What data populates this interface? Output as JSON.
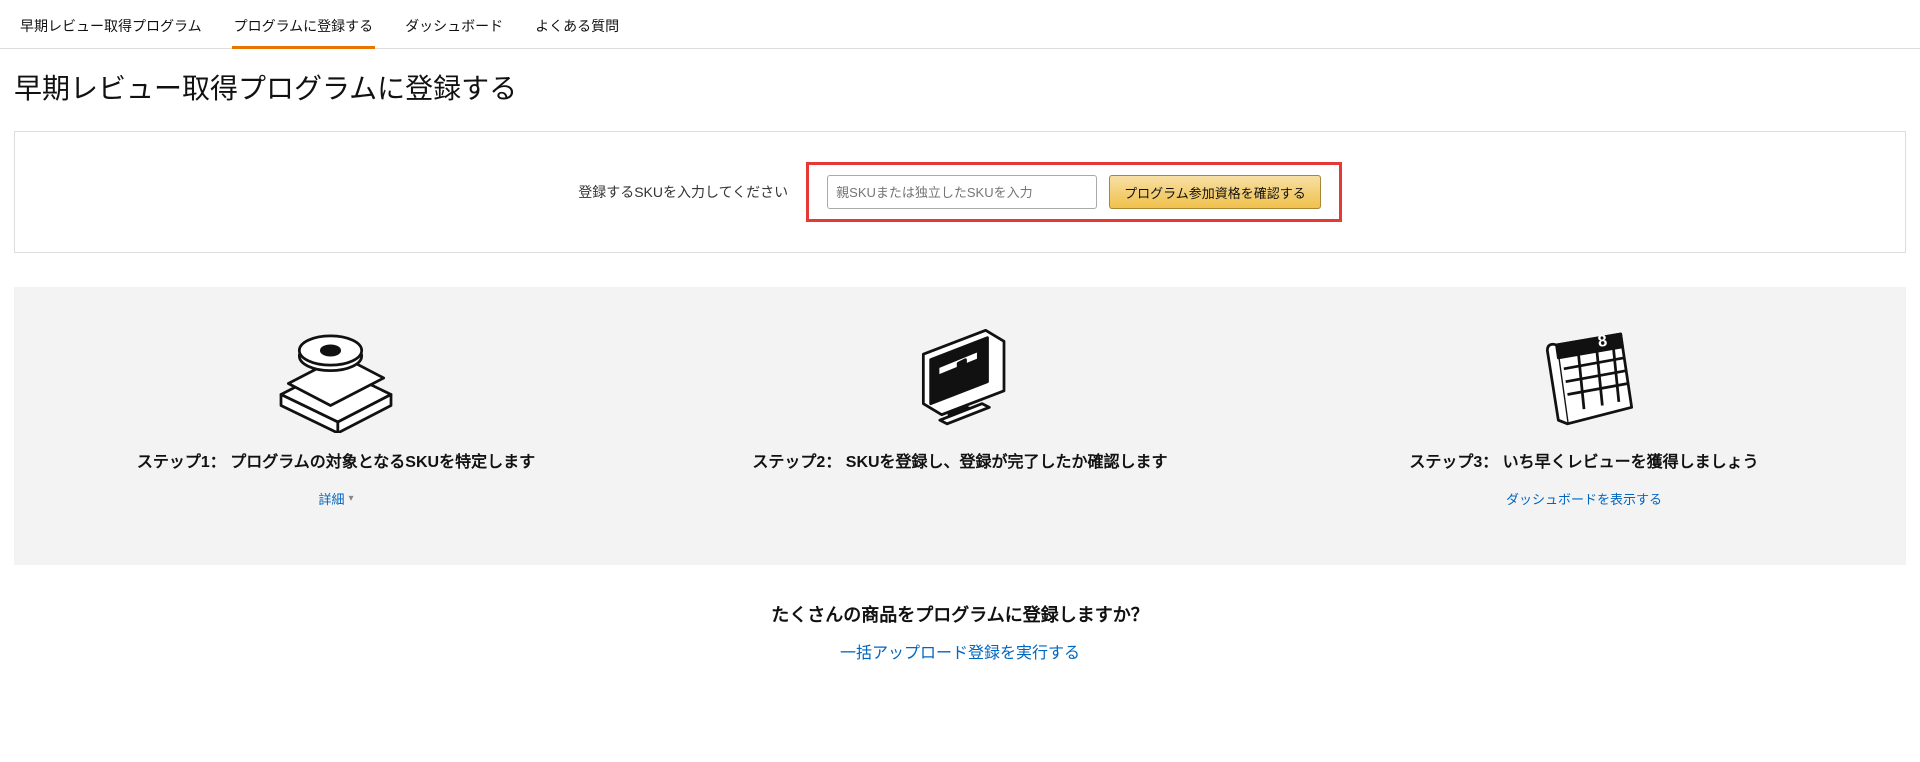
{
  "tabs": {
    "t0": "早期レビュー取得プログラム",
    "t1": "プログラムに登録する",
    "t2": "ダッシュボード",
    "t3": "よくある質問"
  },
  "page_title": "早期レビュー取得プログラムに登録する",
  "input_panel": {
    "label": "登録するSKUを入力してください",
    "placeholder": "親SKUまたは独立したSKUを入力",
    "button": "プログラム参加資格を確認する"
  },
  "steps": {
    "s1_title": "ステップ1： プログラムの対象となるSKUを特定します",
    "s1_link": "詳細",
    "s2_title": "ステップ2： SKUを登録し、登録が完了したか確認します",
    "s3_title": "ステップ3： いち早くレビューを獲得しましょう",
    "s3_link": "ダッシュボードを表示する"
  },
  "bottom": {
    "q": "たくさんの商品をプログラムに登録しますか？",
    "link": "一括アップロード登録を実行する"
  }
}
